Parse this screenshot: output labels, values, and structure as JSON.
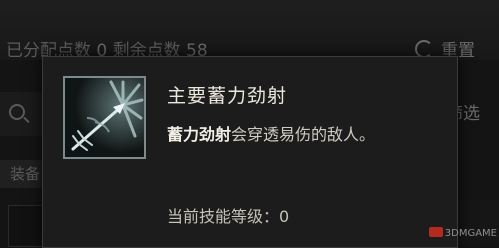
{
  "background": {
    "points_label": "已分配点数",
    "points_value": "0",
    "remaining_label": "剩余点数",
    "remaining_value": "58",
    "reset_label": "重置",
    "filter_label": "筛选",
    "equip_label": "装备"
  },
  "tooltip": {
    "icon": "piercing-arrow-icon",
    "title": "主要蓄力劲射",
    "desc_highlight": "蓄力劲射",
    "desc_rest": "会穿透易伤的敌人。",
    "level_label": "当前技能等级：",
    "level_value": "0"
  },
  "watermark": "3DMGAME",
  "colors": {
    "tooltip_bg": "#1c1c1c",
    "title": "#ece8de",
    "icon_frame": "#7b8b8b",
    "icon_art": "#c8dede"
  }
}
